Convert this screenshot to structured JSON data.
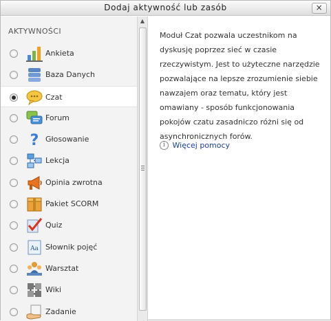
{
  "dialog": {
    "title": "Dodaj aktywność lub zasób",
    "close_label": "×"
  },
  "options": {
    "section_heading": "AKTYWNOŚCI",
    "items": [
      {
        "label": "Ankieta",
        "icon": "bar-chart-icon",
        "selected": false
      },
      {
        "label": "Baza Danych",
        "icon": "database-icon",
        "selected": false
      },
      {
        "label": "Czat",
        "icon": "chat-icon",
        "selected": true
      },
      {
        "label": "Forum",
        "icon": "forum-icon",
        "selected": false
      },
      {
        "label": "Głosowanie",
        "icon": "question-mark-icon",
        "selected": false
      },
      {
        "label": "Lekcja",
        "icon": "lesson-icon",
        "selected": false
      },
      {
        "label": "Opinia zwrotna",
        "icon": "megaphone-icon",
        "selected": false
      },
      {
        "label": "Pakiet SCORM",
        "icon": "package-icon",
        "selected": false
      },
      {
        "label": "Quiz",
        "icon": "quiz-checkmark-icon",
        "selected": false
      },
      {
        "label": "Słownik pojęć",
        "icon": "glossary-icon",
        "selected": false
      },
      {
        "label": "Warsztat",
        "icon": "workshop-people-icon",
        "selected": false
      },
      {
        "label": "Wiki",
        "icon": "wiki-icon",
        "selected": false
      },
      {
        "label": "Zadanie",
        "icon": "assignment-hand-icon",
        "selected": false
      }
    ]
  },
  "description": {
    "text": "Moduł Czat pozwala uczestnikom na dyskusję poprzez sieć w czasie rzeczywistym. Jest to użyteczne narzędzie pozwalające na lepsze zrozumienie siebie nawzajem oraz tematu, który jest omawiany - sposób funkcjonowania pokojów czatu zasadniczo różni się od asynchronicznych forów.",
    "help_label": "Więcej pomocy",
    "help_icon_glyph": "i"
  },
  "colors": {
    "accent_link": "#1a3fa0",
    "panel_background": "#f3f3f3",
    "selected_background": "#ffffff"
  }
}
